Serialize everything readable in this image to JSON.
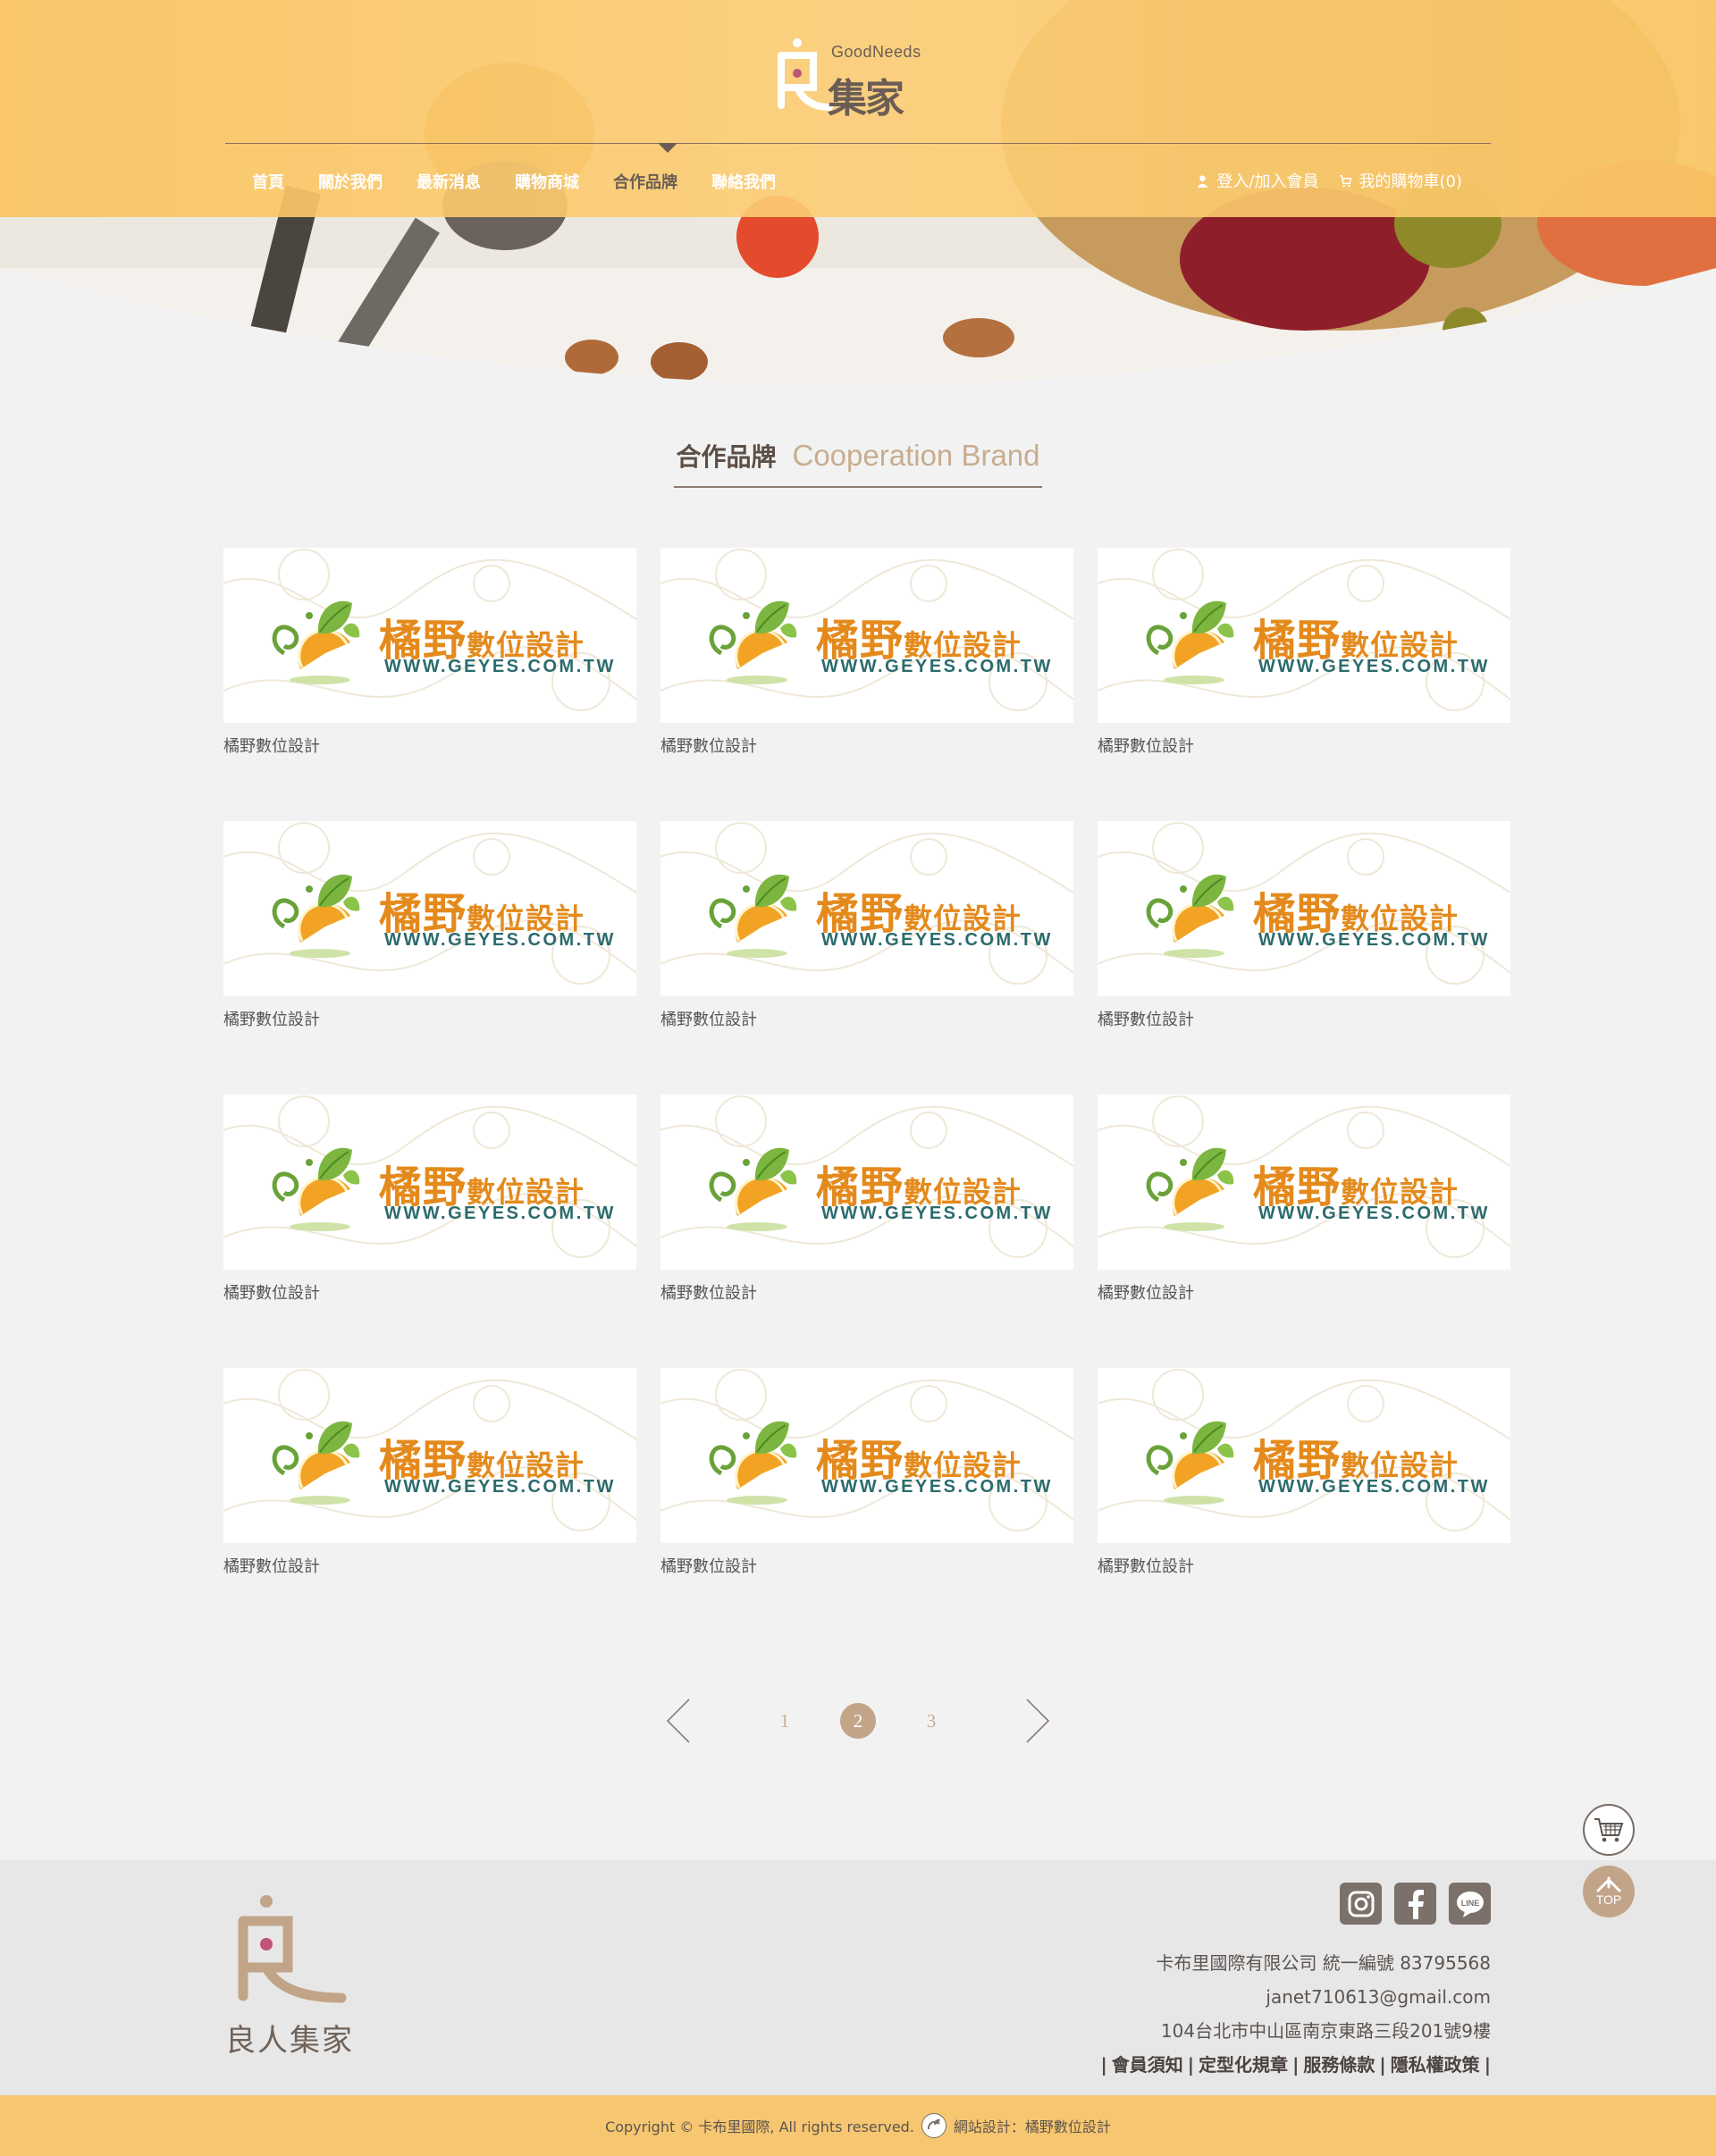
{
  "header": {
    "logo_en": "GoodNeeds",
    "logo_zh": "集家",
    "nav": [
      {
        "label": "首頁"
      },
      {
        "label": "關於我們"
      },
      {
        "label": "最新消息"
      },
      {
        "label": "購物商城"
      },
      {
        "label": "合作品牌"
      },
      {
        "label": "聯絡我們"
      }
    ],
    "active_nav": "合作品牌",
    "login_label": "登入/加入會員",
    "cart_label": "我的購物車(0)"
  },
  "section": {
    "title_zh": "合作品牌",
    "title_en": "Cooperation Brand"
  },
  "brands": [
    {
      "logo_zh_big": "橘野",
      "logo_zh_small": "數位設計",
      "logo_url": "WWW.GEYES.COM.TW",
      "caption": "橘野數位設計"
    },
    {
      "logo_zh_big": "橘野",
      "logo_zh_small": "數位設計",
      "logo_url": "WWW.GEYES.COM.TW",
      "caption": "橘野數位設計"
    },
    {
      "logo_zh_big": "橘野",
      "logo_zh_small": "數位設計",
      "logo_url": "WWW.GEYES.COM.TW",
      "caption": "橘野數位設計"
    },
    {
      "logo_zh_big": "橘野",
      "logo_zh_small": "數位設計",
      "logo_url": "WWW.GEYES.COM.TW",
      "caption": "橘野數位設計"
    },
    {
      "logo_zh_big": "橘野",
      "logo_zh_small": "數位設計",
      "logo_url": "WWW.GEYES.COM.TW",
      "caption": "橘野數位設計"
    },
    {
      "logo_zh_big": "橘野",
      "logo_zh_small": "數位設計",
      "logo_url": "WWW.GEYES.COM.TW",
      "caption": "橘野數位設計"
    },
    {
      "logo_zh_big": "橘野",
      "logo_zh_small": "數位設計",
      "logo_url": "WWW.GEYES.COM.TW",
      "caption": "橘野數位設計"
    },
    {
      "logo_zh_big": "橘野",
      "logo_zh_small": "數位設計",
      "logo_url": "WWW.GEYES.COM.TW",
      "caption": "橘野數位設計"
    },
    {
      "logo_zh_big": "橘野",
      "logo_zh_small": "數位設計",
      "logo_url": "WWW.GEYES.COM.TW",
      "caption": "橘野數位設計"
    },
    {
      "logo_zh_big": "橘野",
      "logo_zh_small": "數位設計",
      "logo_url": "WWW.GEYES.COM.TW",
      "caption": "橘野數位設計"
    },
    {
      "logo_zh_big": "橘野",
      "logo_zh_small": "數位設計",
      "logo_url": "WWW.GEYES.COM.TW",
      "caption": "橘野數位設計"
    },
    {
      "logo_zh_big": "橘野",
      "logo_zh_small": "數位設計",
      "logo_url": "WWW.GEYES.COM.TW",
      "caption": "橘野數位設計"
    }
  ],
  "pagination": {
    "pages": [
      "1",
      "2",
      "3"
    ],
    "current": "2"
  },
  "floating": {
    "top_label": "TOP"
  },
  "footer": {
    "logo_name": "良人集家",
    "company": "卡布里國際有限公司  統一編號 83795568",
    "email": "janet710613@gmail.com",
    "address": "104台北市中山區南京東路三段201號9樓",
    "links": [
      "會員須知",
      "定型化規章",
      "服務條款",
      "隱私權政策"
    ],
    "social_icons": [
      "instagram-icon",
      "facebook-icon",
      "line-icon"
    ],
    "copyright": "Copyright © 卡布里國際, All rights reserved.",
    "design_credit": "網站設計：橘野數位設計"
  },
  "colors": {
    "header_band": "#fac460",
    "accent_brown": "#c2a488",
    "text_dark": "#5c4e45",
    "brand_orange": "#e48a1c",
    "brand_teal": "#2b6b6e",
    "footer_bar": "#f7c670"
  }
}
